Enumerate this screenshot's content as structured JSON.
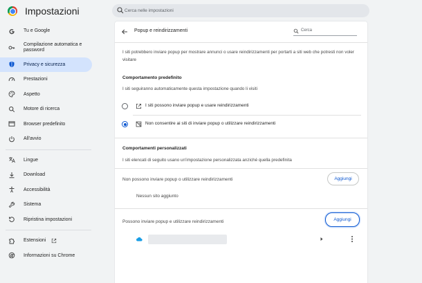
{
  "app": {
    "title": "Impostazioni"
  },
  "search": {
    "placeholder": "Cerca nelle impostazioni"
  },
  "sidebar": {
    "items": [
      {
        "label": "Tu e Google",
        "icon": "google-g-icon"
      },
      {
        "label": "Compilazione automatica e password",
        "icon": "key-icon"
      },
      {
        "label": "Privacy e sicurezza",
        "icon": "shield-icon",
        "active": true
      },
      {
        "label": "Prestazioni",
        "icon": "speedometer-icon"
      },
      {
        "label": "Aspetto",
        "icon": "palette-icon"
      },
      {
        "label": "Motore di ricerca",
        "icon": "search-icon"
      },
      {
        "label": "Browser predefinito",
        "icon": "browser-window-icon"
      },
      {
        "label": "All'avvio",
        "icon": "power-icon"
      },
      {
        "label": "Lingue",
        "icon": "translate-icon"
      },
      {
        "label": "Download",
        "icon": "download-icon"
      },
      {
        "label": "Accessibilità",
        "icon": "accessibility-icon"
      },
      {
        "label": "Sistema",
        "icon": "wrench-icon"
      },
      {
        "label": "Ripristina impostazioni",
        "icon": "reset-icon"
      },
      {
        "label": "Estensioni",
        "icon": "extension-icon"
      },
      {
        "label": "Informazioni su Chrome",
        "icon": "chrome-icon"
      }
    ]
  },
  "page": {
    "title": "Popup e reindirizzamenti",
    "search_label": "Cerca",
    "description": "I siti potrebbero inviare popup per mostrare annunci o usare reindirizzamenti per portarti a siti web che potresti non voler visitare",
    "default_section": {
      "title": "Comportamento predefinito",
      "subtitle": "I siti seguiranno automaticamente questa impostazione quando li visiti",
      "options": [
        {
          "label": "I siti possono inviare popup e usare reindirizzamenti",
          "icon": "open-in-new-icon",
          "selected": false
        },
        {
          "label": "Non consentire ai siti di inviare popup o utilizzare reindirizzamenti",
          "icon": "blocked-popup-icon",
          "selected": true
        }
      ]
    },
    "custom_section": {
      "title": "Comportamenti personalizzati",
      "subtitle": "I siti elencati di seguito usano un'impostazione personalizzata anziché quella predefinita",
      "block_label": "Non possono inviare popup o utilizzare reindirizzamenti",
      "block_add": "Aggiungi",
      "block_empty": "Nessun sito aggiunto",
      "allow_label": "Possono inviare popup e utilizzare reindirizzamenti",
      "allow_add": "Aggiungi"
    }
  },
  "colors": {
    "accent": "#0b57d0",
    "active_nav": "#d3e3fd",
    "background": "#f1f3f4"
  }
}
